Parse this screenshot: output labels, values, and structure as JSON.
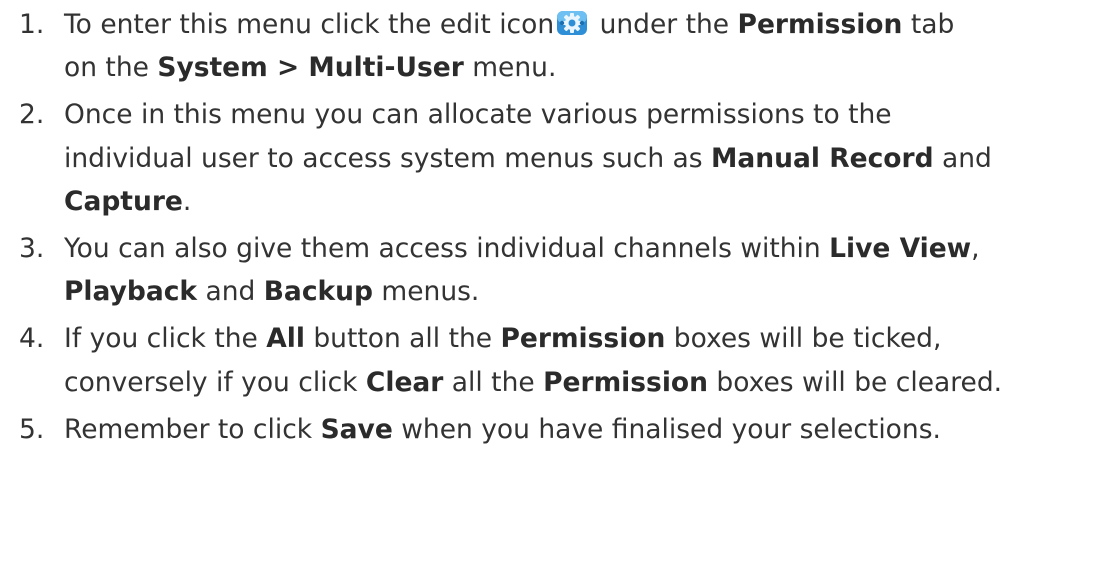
{
  "steps": [
    {
      "number": "1.",
      "line1": {
        "t1": "To enter this menu click the edit icon",
        "t2": " under the ",
        "b1": "Permission",
        "t3": " tab"
      },
      "line2": {
        "t1": "on the ",
        "b1": "System > Multi-User",
        "t2": " menu."
      }
    },
    {
      "number": "2.",
      "line1": {
        "t1": "Once in this menu you can allocate various permissions to the"
      },
      "line2": {
        "t1": "individual user to access system menus such as ",
        "b1": "Manual Record",
        "t2": " and"
      },
      "line3": {
        "b1": "Capture",
        "t1": "."
      }
    },
    {
      "number": "3.",
      "line1": {
        "t1": "You can also give them access individual channels within ",
        "b1": "Live View",
        "t2": ","
      },
      "line2": {
        "b1": "Playback",
        "t1": " and ",
        "b2": "Backup",
        "t2": " menus."
      }
    },
    {
      "number": "4.",
      "line1": {
        "t1": "If you click the ",
        "b1": "All",
        "t2": " button all the ",
        "b2": "Permission",
        "t3": " boxes will be ticked,"
      },
      "line2": {
        "t1": "conversely if you click ",
        "b1": "Clear",
        "t2": " all the ",
        "b2": "Permission",
        "t3": " boxes will be cleared."
      }
    },
    {
      "number": "5.",
      "line1": {
        "t1": "Remember to click ",
        "b1": "Save",
        "t2": " when you have finalised your selections."
      }
    }
  ],
  "icons": {
    "edit": "gear-edit-icon"
  },
  "colors": {
    "text": "#333333",
    "icon_blue": "#3a9ad9"
  }
}
